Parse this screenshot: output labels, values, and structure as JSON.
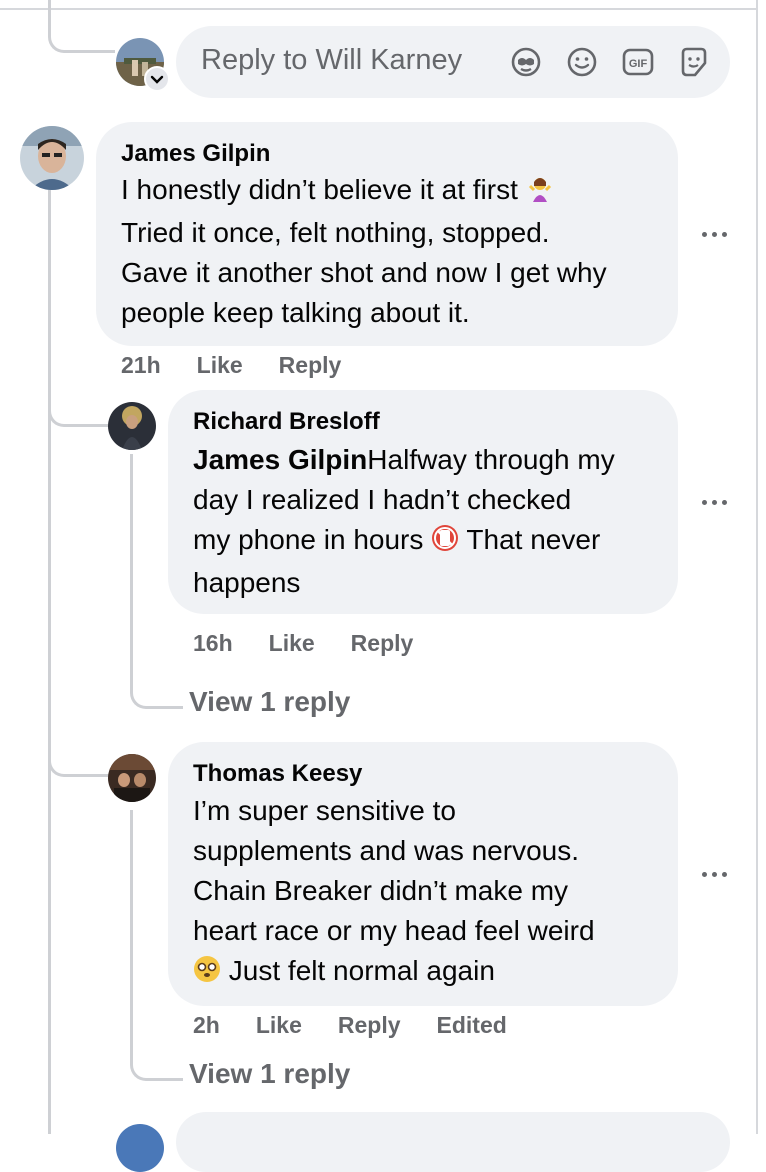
{
  "reply_box": {
    "placeholder": "Reply to Will Karney",
    "icons": [
      "avatar-sticker-icon",
      "emoji-icon",
      "gif-icon",
      "sticker-icon"
    ]
  },
  "comments": [
    {
      "author": "James Gilpin",
      "text": "I honestly didn’t believe it at first",
      "text_line2": "Tried it once, felt nothing, stopped.",
      "text_line3": "Gave it another shot and now I get why",
      "text_line4": "people keep talking about it.",
      "emoji": "woman-shrugging-emoji",
      "time": "21h",
      "like": "Like",
      "reply": "Reply"
    },
    {
      "author": "Richard Bresloff",
      "mention": "James Gilpin",
      "text_line1": "Halfway through my",
      "text_line2": "day I realized I hadn’t checked",
      "text_line3a": "my phone in hours",
      "text_line3b": "That never",
      "text_line4": "happens",
      "emoji": "no-mobile-phones-emoji",
      "time": "16h",
      "like": "Like",
      "reply": "Reply",
      "view_replies": "View 1 reply"
    },
    {
      "author": "Thomas Keesy",
      "text_line1": "I’m super sensitive to",
      "text_line2": "supplements and was nervous.",
      "text_line3": "Chain Breaker didn’t make my",
      "text_line4": "heart race or my head feel weird",
      "text_line5": "Just felt normal again",
      "emoji": "dizzy-face-emoji",
      "time": "2h",
      "like": "Like",
      "reply": "Reply",
      "edited": "Edited",
      "view_replies": "View 1 reply"
    }
  ],
  "colors": {
    "bubble": "#f0f2f5",
    "meta_text": "#65676b",
    "thread_line": "#ced0d4"
  }
}
